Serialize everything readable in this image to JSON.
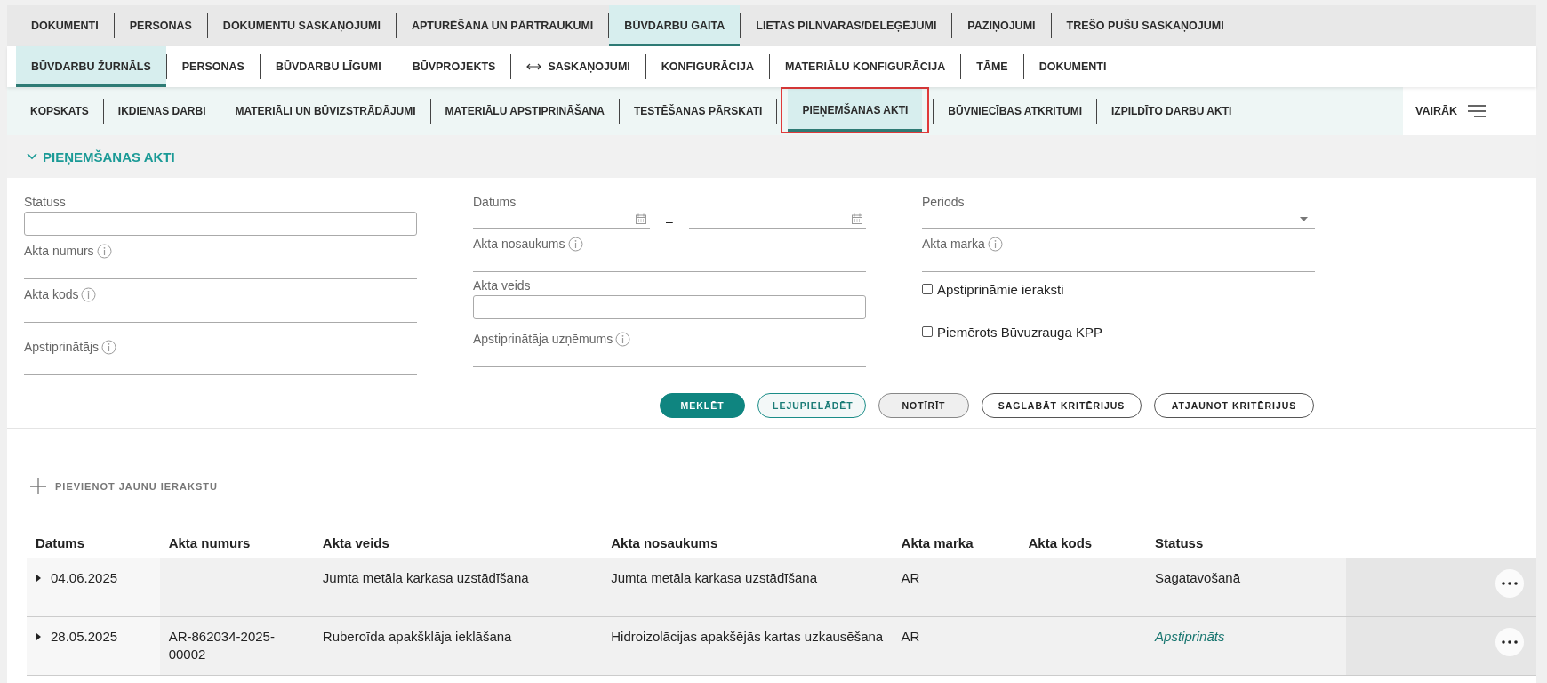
{
  "nav_primary": [
    {
      "label": "DOKUMENTI",
      "selected": false
    },
    {
      "label": "PERSONAS",
      "selected": false
    },
    {
      "label": "DOKUMENTU SASKAŅOJUMI",
      "selected": false
    },
    {
      "label": "APTURĒŠANA UN PĀRTRAUKUMI",
      "selected": false
    },
    {
      "label": "BŪVDARBU GAITA",
      "selected": true
    },
    {
      "label": "LIETAS PILNVARAS/DELEĢĒJUMI",
      "selected": false
    },
    {
      "label": "PAZIŅOJUMI",
      "selected": false
    },
    {
      "label": "TREŠO PUŠU SASKAŅOJUMI",
      "selected": false
    }
  ],
  "nav_secondary": [
    {
      "label": "BŪVDARBU ŽURNĀLS",
      "selected": true
    },
    {
      "label": "PERSONAS",
      "selected": false
    },
    {
      "label": "BŪVDARBU LĪGUMI",
      "selected": false
    },
    {
      "label": "BŪVPROJEKTS",
      "selected": false
    },
    {
      "label": "SASKAŅOJUMI",
      "selected": false,
      "kind": "linked"
    },
    {
      "label": "KONFIGURĀCIJA",
      "selected": false
    },
    {
      "label": "MATERIĀLU KONFIGURĀCIJA",
      "selected": false
    },
    {
      "label": "TĀME",
      "selected": false
    },
    {
      "label": "DOKUMENTI",
      "selected": false
    }
  ],
  "nav_tertiary": [
    {
      "label": "KOPSKATS",
      "selected": false,
      "highlighted": false
    },
    {
      "label": "IKDIENAS DARBI",
      "selected": false,
      "highlighted": false
    },
    {
      "label": "MATERIĀLI UN BŪVIZSTRĀDĀJUMI",
      "selected": false,
      "highlighted": false
    },
    {
      "label": "MATERIĀLU APSTIPRINĀŠANA",
      "selected": false,
      "highlighted": false
    },
    {
      "label": "TESTĒŠANAS PĀRSKATI",
      "selected": false,
      "highlighted": false
    },
    {
      "label": "PIEŅEMŠANAS AKTI",
      "selected": true,
      "highlighted": true
    },
    {
      "label": "BŪVNIECĪBAS ATKRITUMI",
      "selected": false,
      "highlighted": false
    },
    {
      "label": "IZPILDĪTO DARBU AKTI",
      "selected": false,
      "highlighted": false
    }
  ],
  "more_button": {
    "label": "VAIRĀK"
  },
  "section": {
    "title": "PIEŅEMŠANAS AKTI",
    "expanded": true
  },
  "filter_columns": [
    [
      {
        "kind": "boxed",
        "label": "Statuss"
      },
      {
        "kind": "line",
        "label": "Akta numurs",
        "info": true
      },
      {
        "kind": "line",
        "label": "Akta kods",
        "info": true
      },
      {
        "kind": "line",
        "label": "Apstiprinātājs",
        "info": true
      }
    ],
    [
      {
        "kind": "date_range",
        "label": "Datums",
        "separator": "–"
      },
      {
        "kind": "line",
        "label": "Akta nosaukums",
        "info": true
      },
      {
        "kind": "boxed",
        "label": "Akta veids"
      },
      {
        "kind": "line",
        "label": "Apstiprinātāja uzņēmums",
        "info": true
      }
    ],
    [
      {
        "kind": "select",
        "label": "Periods"
      },
      {
        "kind": "line",
        "label": "Akta marka",
        "info": true
      },
      {
        "kind": "checkbox",
        "label": "Apstiprināmie ieraksti",
        "checked": false
      },
      {
        "kind": "checkbox",
        "label": "Piemērots Būvuzrauga KPP",
        "checked": false
      }
    ]
  ],
  "buttons": [
    {
      "label": "MEKLĒT",
      "kind": "primary"
    },
    {
      "label": "LEJUPIELĀDĒT",
      "kind": "accent"
    },
    {
      "label": "NOTĪRĪT",
      "kind": "grey"
    },
    {
      "label": "SAGLABĀT KRITĒRIJUS",
      "kind": "outline"
    },
    {
      "label": "ATJAUNOT KRITĒRIJUS",
      "kind": "outline"
    }
  ],
  "add_link": {
    "label": "PIEVIENOT JAUNU IERAKSTU"
  },
  "table": {
    "columns": [
      "Datums",
      "Akta numurs",
      "Akta veids",
      "Akta nosaukums",
      "Akta marka",
      "Akta kods",
      "Statuss"
    ],
    "rows": [
      {
        "expanded": false,
        "approved": false,
        "cells": [
          "04.06.2025",
          "",
          "Jumta metāla karkasa uzstādīšana",
          "Jumta metāla karkasa uzstādīšana",
          "AR",
          "",
          "Sagatavošanā"
        ]
      },
      {
        "expanded": false,
        "approved": true,
        "cells": [
          "28.05.2025",
          "AR-862034-2025-00002",
          "Ruberoīda apakšklāja ieklāšana",
          "Hidroizolācijas apakšējās kartas uzkausēšana",
          "AR",
          "",
          "Apstiprināts"
        ]
      }
    ]
  }
}
